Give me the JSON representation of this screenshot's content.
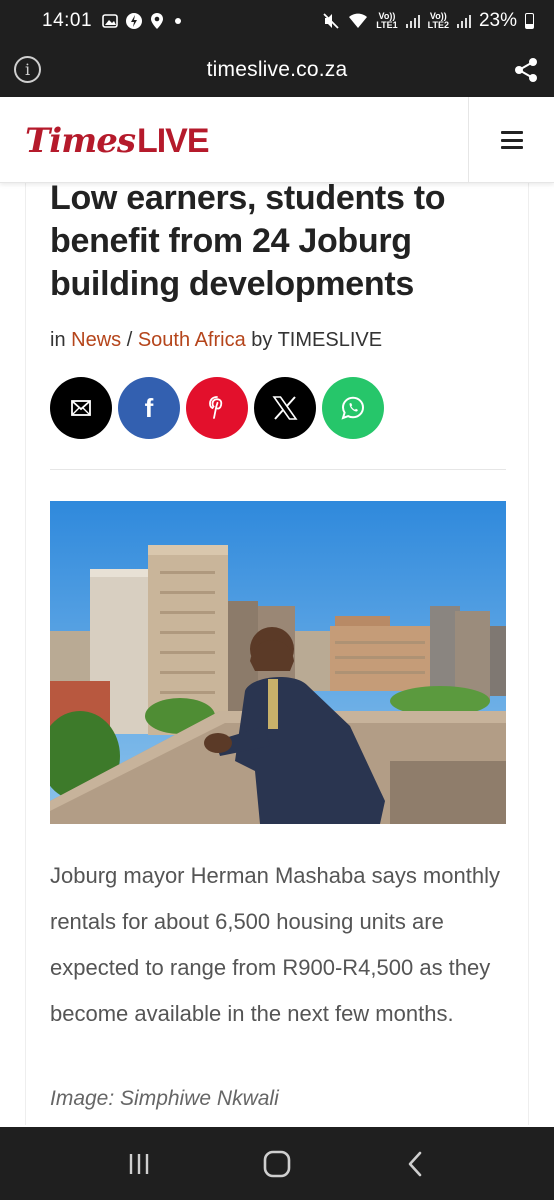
{
  "status_bar": {
    "time": "14:01",
    "battery": "23%",
    "sim1": "LTE1",
    "sim2": "LTE2",
    "volte": "Vo))"
  },
  "url_bar": {
    "url": "timeslive.co.za"
  },
  "header": {
    "logo_times": "Times",
    "logo_live": "LIVE",
    "brand_color": "#b51a2b"
  },
  "article": {
    "headline": "Low earners, students to benefit from 24 Joburg building developments",
    "byline": {
      "in": "in",
      "category1": "News",
      "separator": "/",
      "category2": "South Africa",
      "by": "by",
      "author": "TIMESLIVE"
    },
    "share_buttons": [
      {
        "icon": "email-icon",
        "color": "#000000"
      },
      {
        "icon": "facebook-icon",
        "color": "#3360b0"
      },
      {
        "icon": "pinterest-icon",
        "color": "#e3102c"
      },
      {
        "icon": "x-icon",
        "color": "#000000"
      },
      {
        "icon": "whatsapp-icon",
        "color": "#26c66a"
      }
    ],
    "share_glyphs": {
      "facebook": "f"
    },
    "caption": "Joburg mayor Herman Mashaba says monthly rentals for about 6,500 housing units are expected to range from R900-R4,500 as they become available in the next few months.",
    "credit": "Image: Simphiwe Nkwali"
  },
  "nav_bar": {
    "buttons": [
      "recents-icon",
      "home-icon",
      "back-icon"
    ]
  }
}
